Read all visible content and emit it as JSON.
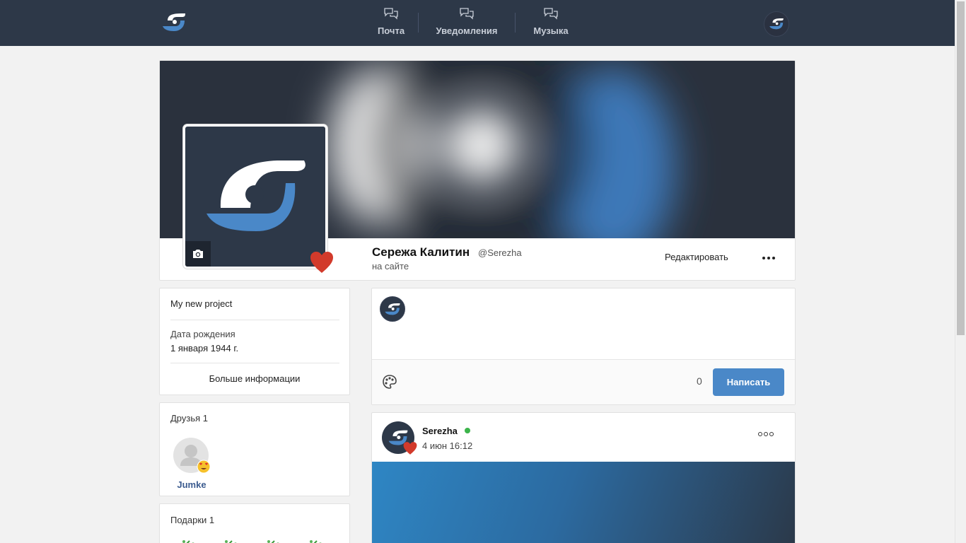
{
  "nav": {
    "items": [
      {
        "label": "Почта",
        "icon": "chat-bubbles-icon"
      },
      {
        "label": "Уведомления",
        "icon": "chat-bubbles-icon"
      },
      {
        "label": "Музыка",
        "icon": "chat-bubbles-icon"
      }
    ]
  },
  "profile": {
    "name": "Сережа Калитин",
    "nick": "@Serezha",
    "status": "на сайте",
    "edit_label": "Редактировать"
  },
  "info": {
    "about": "My new project",
    "birth_label": "Дата рождения",
    "birth_value": "1 января 1944 г.",
    "more_label": "Больше информации"
  },
  "friends": {
    "title": "Друзья 1",
    "items": [
      {
        "name": "Jumke"
      }
    ]
  },
  "gifts": {
    "title": "Подарки 1"
  },
  "compose": {
    "counter": "0",
    "send_label": "Написать"
  },
  "post": {
    "author": "Serezha",
    "time": "4 июн 16:12"
  },
  "colors": {
    "topbar": "#2d3848",
    "accent": "#4a88c8",
    "heart": "#d23a2b",
    "online": "#3cb44b"
  }
}
